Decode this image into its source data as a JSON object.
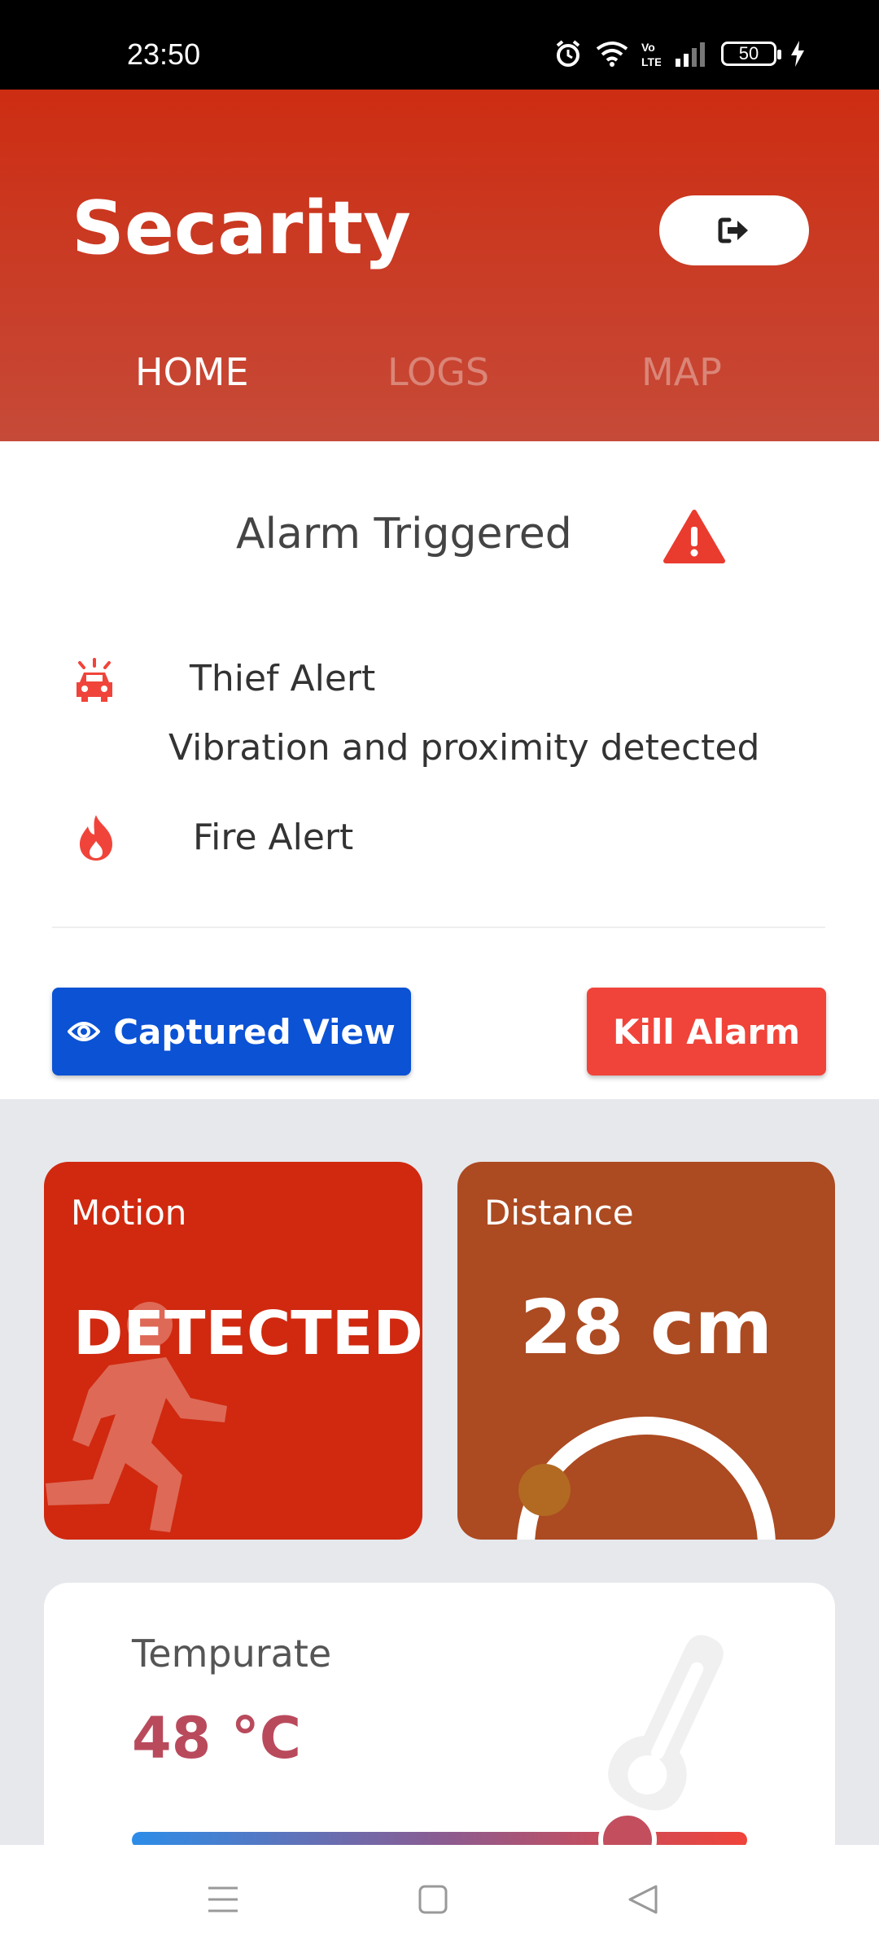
{
  "status_bar": {
    "time": "23:50",
    "battery": "50",
    "icons": [
      "alarm-icon",
      "wifi-icon",
      "volte-icon",
      "signal-icon",
      "battery-icon",
      "charging-icon"
    ]
  },
  "header": {
    "title": "Secarity",
    "logout_icon": "logout-icon",
    "tabs": [
      {
        "label": "HOME",
        "active": true
      },
      {
        "label": "LOGS",
        "active": false
      },
      {
        "label": "MAP",
        "active": false
      }
    ],
    "colors": {
      "top": "#cd2d12",
      "bottom": "#c64a38"
    }
  },
  "alarm": {
    "title": "Alarm Triggered",
    "icon": "warning-icon",
    "alerts": [
      {
        "icon": "car-siren-icon",
        "label": "Thief Alert",
        "detail": "Vibration and proximity detected"
      },
      {
        "icon": "fire-icon",
        "label": "Fire Alert"
      }
    ]
  },
  "buttons": {
    "captured_view": "Captured View",
    "captured_view_icon": "eye-icon",
    "kill_alarm": "Kill Alarm"
  },
  "cards": {
    "motion": {
      "label": "Motion",
      "value": "DETECTED",
      "icon": "running-person-icon",
      "color": "#d0290f"
    },
    "distance": {
      "label": "Distance",
      "value": "28 cm",
      "color": "#ac4a21"
    },
    "temperature": {
      "label": "Tempurate",
      "value": "48 °C",
      "icon": "thermometer-icon",
      "level": 0.81
    }
  },
  "nav": [
    "menu-icon",
    "home-square-icon",
    "back-triangle-icon"
  ]
}
